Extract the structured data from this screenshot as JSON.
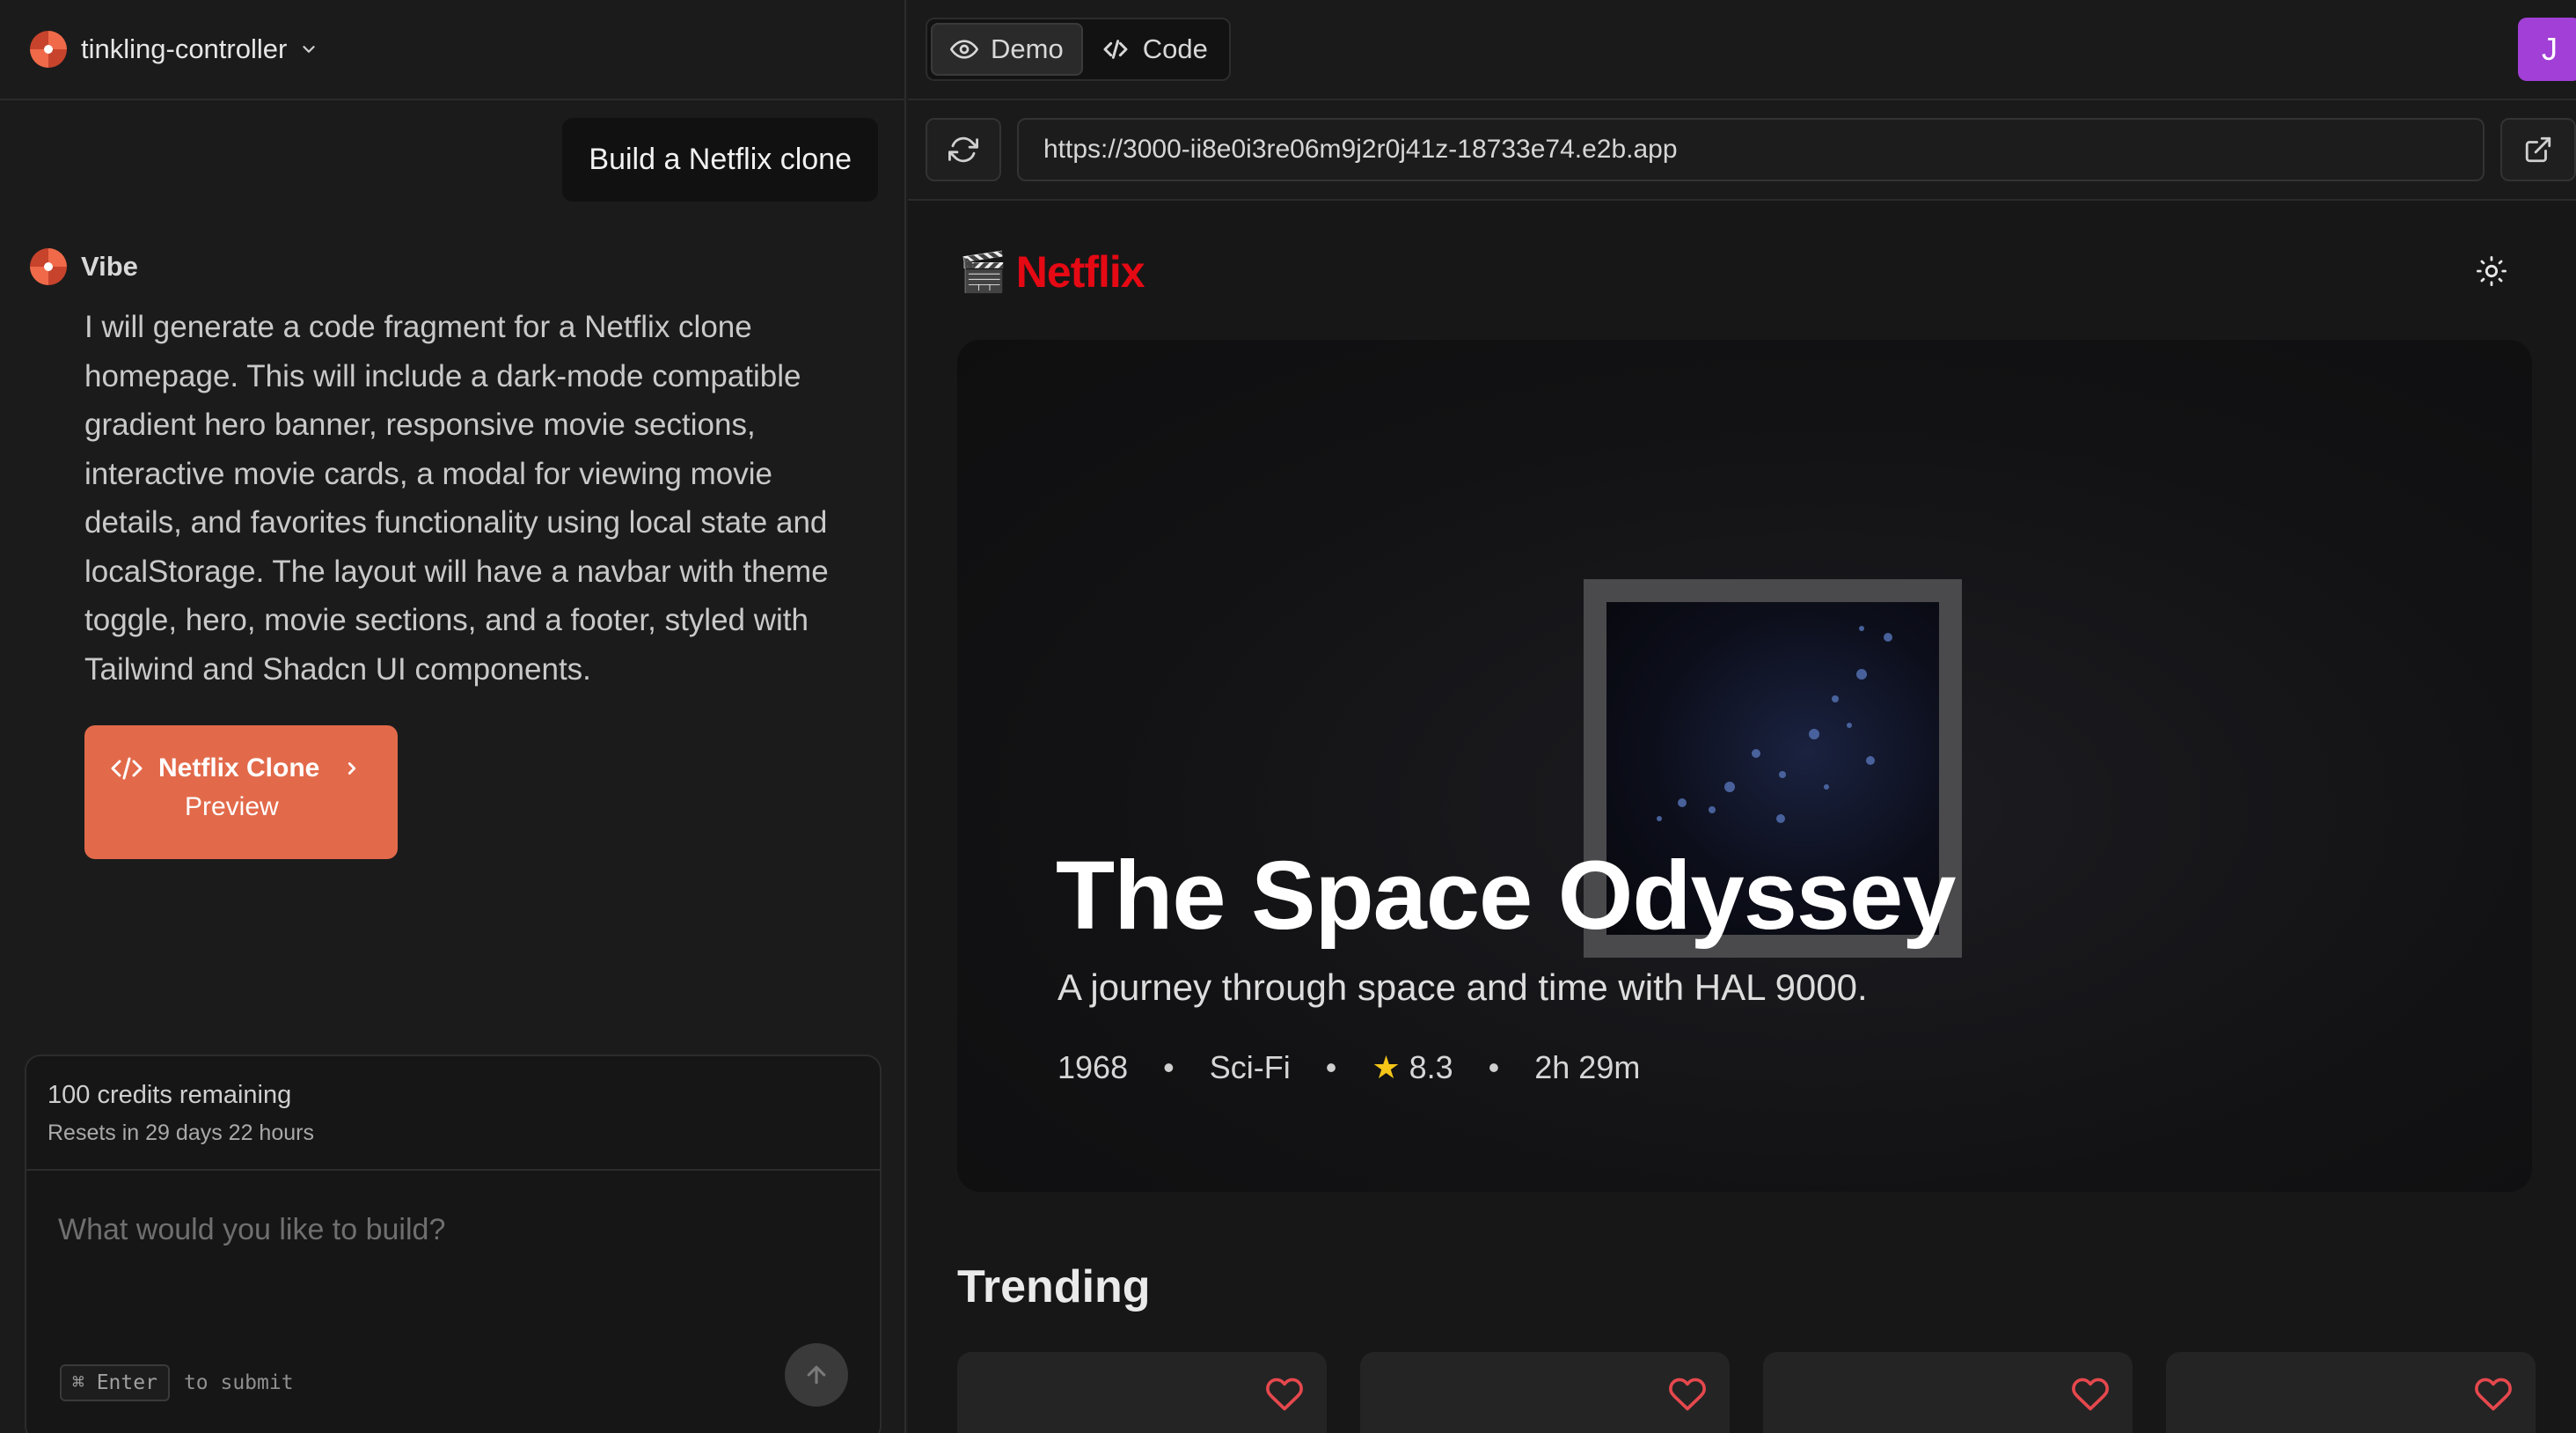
{
  "header": {
    "project_name": "tinkling-controller"
  },
  "chat": {
    "user_message": "Build a Netflix clone",
    "assistant_name": "Vibe",
    "assistant_message": "I will generate a code fragment for a Netflix clone homepage. This will include a dark-mode compatible gradient hero banner, responsive movie sections, interactive movie cards, a modal for viewing movie details, and favorites functionality using local state and localStorage. The layout will have a navbar with theme toggle, hero, movie sections, and a footer, styled with Tailwind and Shadcn UI components.",
    "fragment_title": "Netflix Clone",
    "fragment_subtitle": "Preview"
  },
  "composer": {
    "credits": "100 credits remaining",
    "resets": "Resets in 29 days 22 hours",
    "placeholder": "What would you like to build?",
    "key_hint": "⌘ Enter",
    "key_hint_suffix": "to submit"
  },
  "toolbar": {
    "tab_demo": "Demo",
    "tab_code": "Code",
    "active_tab": "Demo",
    "avatar_initial": "J",
    "url": "https://3000-ii8e0i3re06m9j2r0j41z-18733e74.e2b.app"
  },
  "preview": {
    "logo_emoji": "🎬",
    "logo_text": "Netflix",
    "hero": {
      "title": "The Space Odyssey",
      "description": "A journey through space and time with HAL 9000.",
      "year": "1968",
      "genre": "Sci-Fi",
      "rating": "8.3",
      "runtime": "2h 29m"
    },
    "trending_title": "Trending",
    "card_count_visible": 4
  },
  "colors": {
    "accent": "#e26a4b",
    "netflix_red": "#e50914",
    "avatar": "#a13fd6",
    "star": "#f5c518"
  },
  "icons": [
    "chevron-down-icon",
    "eye-icon",
    "code-icon",
    "refresh-icon",
    "external-link-icon",
    "sun-icon",
    "heart-icon",
    "arrow-up-icon",
    "star-icon"
  ]
}
